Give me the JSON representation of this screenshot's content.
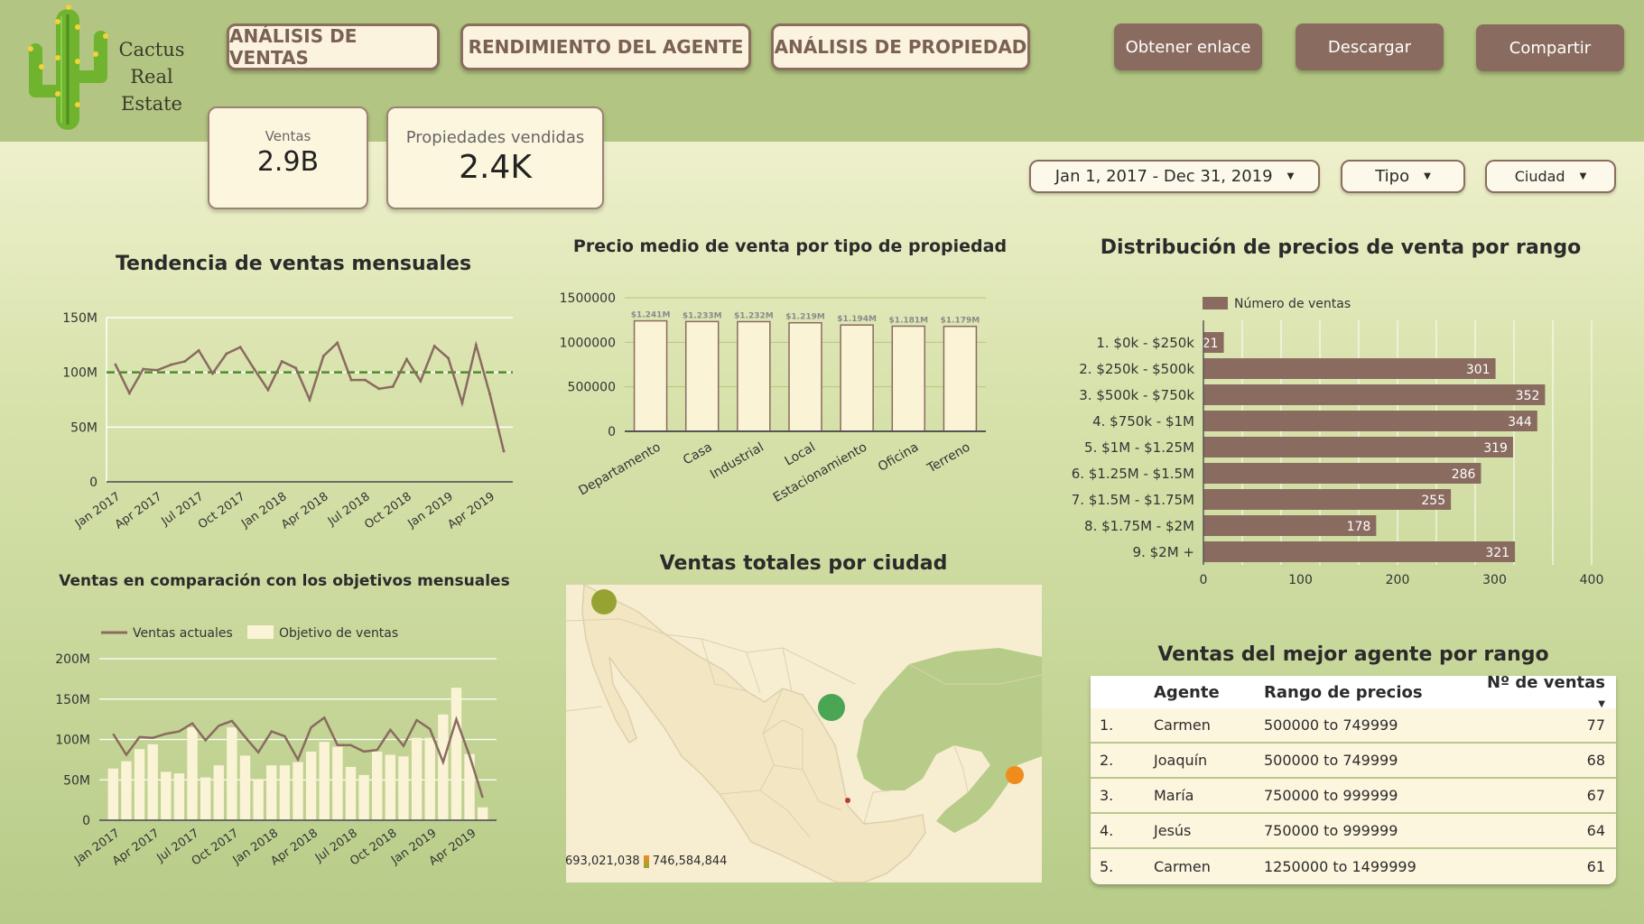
{
  "brand": {
    "name_line1": "Cactus",
    "name_line2": "Real",
    "name_line3": "Estate",
    "icon": "cactus-logo"
  },
  "nav": {
    "tabs": [
      "ANÁLISIS DE VENTAS",
      "RENDIMIENTO DEL AGENTE",
      "ANÁLISIS DE PROPIEDAD"
    ],
    "actions": [
      "Obtener enlace",
      "Descargar",
      "Compartir"
    ]
  },
  "kpis": {
    "ventas": {
      "label": "Ventas",
      "value": "2.9B"
    },
    "vendidas": {
      "label": "Propiedades vendidas",
      "value": "2.4K"
    }
  },
  "filters": {
    "date_range": "Jan 1, 2017 - Dec 31, 2019",
    "tipo": "Tipo",
    "ciudad": "Ciudad"
  },
  "colors": {
    "header": "#b2c582",
    "brown": "#8a6b60",
    "cream": "#fdf6de",
    "line": "#8a6b60",
    "target": "#4f8a2e",
    "bars": "#fbf3d6"
  },
  "chart_data": [
    {
      "type": "line",
      "title": "Tendencia de ventas mensuales",
      "x_tick_labels": [
        "Jan 2017",
        "Apr 2017",
        "Jul 2017",
        "Oct 2017",
        "Jan 2018",
        "Apr 2018",
        "Jul 2018",
        "Oct 2018",
        "Jan 2019",
        "Apr 2019"
      ],
      "y_tick_labels": [
        "150M",
        "100M",
        "50M",
        "0"
      ],
      "ylim": [
        0,
        150
      ],
      "reference_line": 100,
      "series": [
        {
          "values": [
            107,
            81,
            103,
            102,
            107,
            110,
            120,
            99,
            117,
            123,
            103,
            84,
            110,
            104,
            75,
            115,
            127,
            93,
            93,
            85,
            87,
            112,
            92,
            124,
            113,
            72,
            125,
            80,
            28
          ]
        }
      ]
    },
    {
      "type": "bar",
      "title": "Precio medio de venta por tipo de propiedad",
      "categories": [
        "Departamento",
        "Casa",
        "Industrial",
        "Local",
        "Estacionamiento",
        "Oficina",
        "Terreno"
      ],
      "values": [
        1241000,
        1233000,
        1232000,
        1219000,
        1194000,
        1181000,
        1179000
      ],
      "data_labels": [
        "$1.241M",
        "$1.233M",
        "$1.232M",
        "$1.219M",
        "$1.194M",
        "$1.181M",
        "$1.179M"
      ],
      "y_tick_labels": [
        "1500000",
        "1000000",
        "500000",
        "0"
      ],
      "ylim": [
        0,
        1500000
      ]
    },
    {
      "type": "bar",
      "orientation": "horizontal",
      "title": "Distribución de precios de venta por rango",
      "legend": "Número de ventas",
      "categories": [
        "1. $0k - $250k",
        "2. $250k - $500k",
        "3. $500k - $750k",
        "4. $750k - $1M",
        "5. $1M - $1.25M",
        "6. $1.25M - $1.5M",
        "7. $1.5M - $1.75M",
        "8. $1.75M - $2M",
        "9. $2M +"
      ],
      "values": [
        21,
        301,
        352,
        344,
        319,
        286,
        255,
        178,
        321
      ],
      "x_tick_labels": [
        "0",
        "100",
        "200",
        "300",
        "400"
      ],
      "xlim": [
        0,
        400
      ]
    },
    {
      "type": "bar",
      "title": "Ventas en comparación con los objetivos mensuales",
      "legend": [
        "Ventas actuales",
        "Objetivo de ventas"
      ],
      "x_tick_labels": [
        "Jan 2017",
        "Apr 2017",
        "Jul 2017",
        "Oct 2017",
        "Jan 2018",
        "Apr 2018",
        "Jul 2018",
        "Oct 2018",
        "Jan 2019",
        "Apr 2019"
      ],
      "y_tick_labels": [
        "200M",
        "150M",
        "100M",
        "50M",
        "0"
      ],
      "ylim": [
        0,
        200
      ],
      "series": [
        {
          "name": "Ventas actuales",
          "values": [
            107,
            81,
            103,
            102,
            107,
            110,
            120,
            99,
            117,
            123,
            103,
            84,
            110,
            104,
            75,
            115,
            127,
            93,
            93,
            85,
            87,
            112,
            92,
            124,
            113,
            72,
            125,
            80,
            28
          ]
        },
        {
          "name": "Objetivo de ventas",
          "values": [
            64,
            73,
            88,
            94,
            60,
            58,
            115,
            53,
            68,
            115,
            80,
            51,
            68,
            68,
            72,
            85,
            97,
            91,
            66,
            56,
            85,
            81,
            79,
            102,
            102,
            131,
            164,
            82,
            16
          ]
        }
      ]
    }
  ],
  "map": {
    "title": "Ventas totales por ciudad",
    "legend_min": "693,021,038",
    "legend_max": "746,584,844"
  },
  "agents_table": {
    "title": "Ventas del mejor agente por rango",
    "headers": [
      "Agente",
      "Rango de precios",
      "Nº de ventas"
    ],
    "rows": [
      [
        "1.",
        "Carmen",
        "500000 to 749999",
        "77"
      ],
      [
        "2.",
        "Joaquín",
        "500000 to 749999",
        "68"
      ],
      [
        "3.",
        "María",
        "750000 to 999999",
        "67"
      ],
      [
        "4.",
        "Jesús",
        "750000 to 999999",
        "64"
      ],
      [
        "5.",
        "Carmen",
        "1250000 to 1499999",
        "61"
      ]
    ]
  }
}
